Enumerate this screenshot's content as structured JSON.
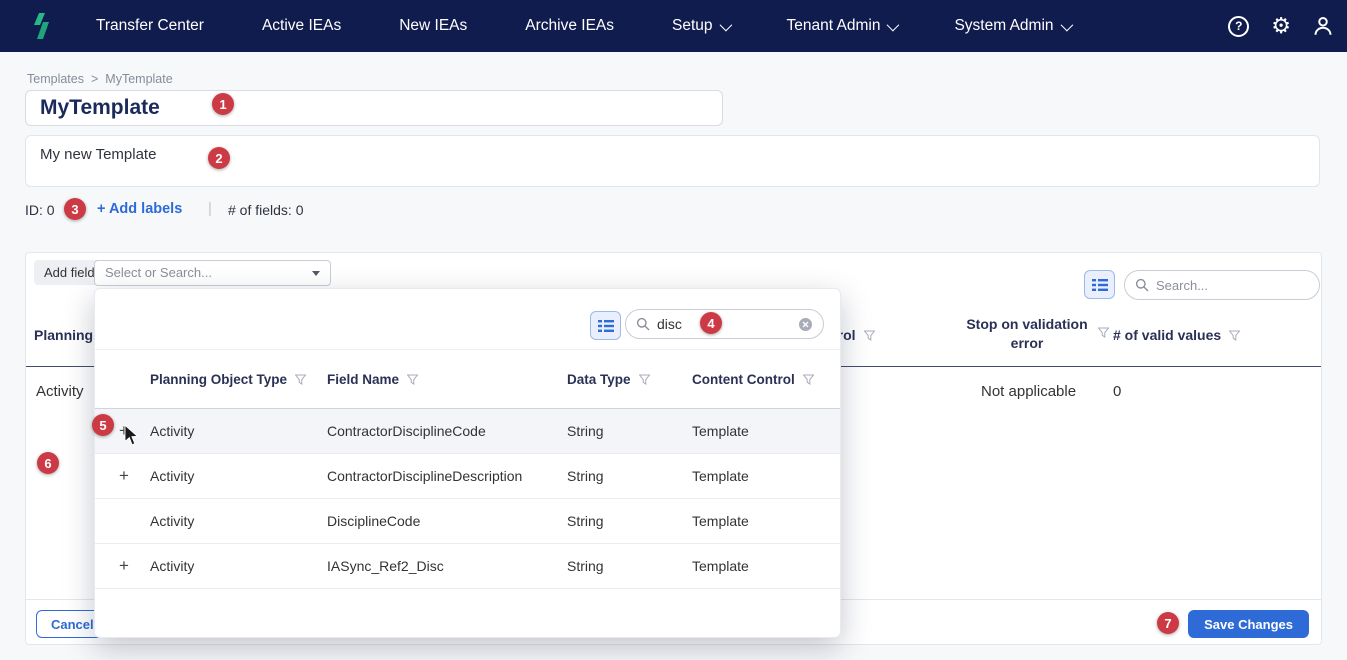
{
  "navbar": {
    "items": [
      {
        "label": "Transfer Center",
        "dropdown": false
      },
      {
        "label": "Active IEAs",
        "dropdown": false
      },
      {
        "label": "New IEAs",
        "dropdown": false
      },
      {
        "label": "Archive IEAs",
        "dropdown": false
      },
      {
        "label": "Setup",
        "dropdown": true
      },
      {
        "label": "Tenant Admin",
        "dropdown": true
      },
      {
        "label": "System Admin",
        "dropdown": true
      }
    ]
  },
  "breadcrumb": {
    "parent": "Templates",
    "separator": ">",
    "current": "MyTemplate"
  },
  "template": {
    "name": "MyTemplate",
    "description": "My new Template",
    "id_label": "ID: 0",
    "add_labels_link": "+ Add labels",
    "divider": "|",
    "fields_count": "# of fields: 0"
  },
  "toolbar": {
    "add_fields_label": "Add fields",
    "select_placeholder": "Select or Search...",
    "search_placeholder": "Search..."
  },
  "main_table": {
    "headers": {
      "planning_object_type": "Planning Object Type",
      "content_control": "Content Control",
      "stop_on_validation": "Stop on validation error",
      "valid_values": "# of valid values"
    },
    "row": {
      "planning_object_type": "Activity",
      "stop_on_validation": "Not applicable",
      "valid_values": "0"
    }
  },
  "popup": {
    "search_value": "disc",
    "headers": {
      "planning_object_type": "Planning Object Type",
      "field_name": "Field Name",
      "data_type": "Data Type",
      "content_control": "Content Control"
    },
    "rows": [
      {
        "add": "+",
        "planning_object_type": "Activity",
        "field_name": "ContractorDisciplineCode",
        "data_type": "String",
        "content_control": "Template"
      },
      {
        "add": "+",
        "planning_object_type": "Activity",
        "field_name": "ContractorDisciplineDescription",
        "data_type": "String",
        "content_control": "Template"
      },
      {
        "add": "",
        "planning_object_type": "Activity",
        "field_name": "DisciplineCode",
        "data_type": "String",
        "content_control": "Template"
      },
      {
        "add": "+",
        "planning_object_type": "Activity",
        "field_name": "IASync_Ref2_Disc",
        "data_type": "String",
        "content_control": "Template"
      }
    ]
  },
  "footer": {
    "cancel_label": "Cancel",
    "save_label": "Save Changes"
  },
  "annotations": {
    "badges": [
      "1",
      "2",
      "3",
      "4",
      "5",
      "6",
      "7"
    ]
  },
  "colors": {
    "accent_blue": "#2e6bd6",
    "badge_red": "#cc3b45",
    "navbar_navy": "#0f1c4d",
    "logo_teal": "#27b78a"
  }
}
